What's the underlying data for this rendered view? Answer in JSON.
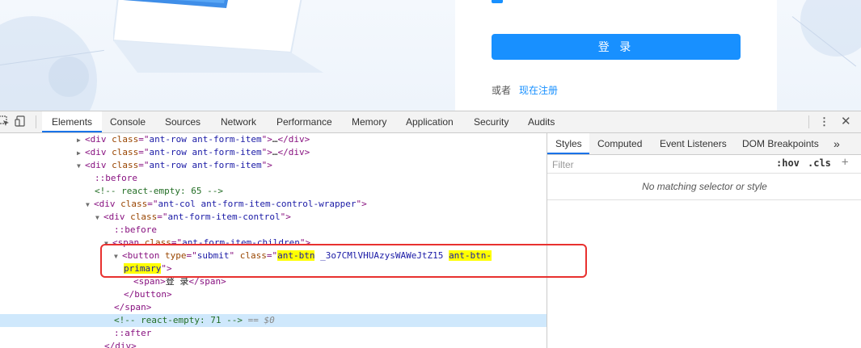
{
  "page": {
    "login_button": "登 录",
    "or_text": "或者",
    "register_link": "现在注册"
  },
  "devtools": {
    "tabs": [
      "Elements",
      "Console",
      "Sources",
      "Network",
      "Performance",
      "Memory",
      "Application",
      "Security",
      "Audits"
    ],
    "active_tab": "Elements",
    "accent_color": "#1a73e8",
    "highlight_color": "#e8312f",
    "icons": [
      "inspect-element-icon",
      "device-toolbar-icon",
      "more-options-icon",
      "close-icon"
    ],
    "dom": {
      "tag_div": "div",
      "attr_class": "class",
      "val_form_item": "ant-row ant-form-item",
      "collapsed_dots": "…",
      "before": "::before",
      "comment_react_65": "<!-- react-empty: 65 -->",
      "val_control_wrapper": "ant-col ant-form-item-control-wrapper",
      "val_form_item_control": "ant-form-item-control",
      "tag_span": "span",
      "val_children": "ant-form-item-children",
      "tag_button": "button",
      "attr_type": "type",
      "val_submit": "submit",
      "val_ant_btn": "ant-btn",
      "val_hash": " _3o7CMlVHUAzysWAWeJtZ15 ",
      "val_ant_btn2": "ant-btn-",
      "val_primary": "primary",
      "span_text": "登 录",
      "close_button": "</button>",
      "close_span": "</span>",
      "comment_react_71": "<!-- react-empty: 71 -->",
      "eq_dollar": " == $0",
      "after": "::after",
      "close_div": "</div>"
    },
    "sidebar": {
      "tabs": [
        "Styles",
        "Computed",
        "Event Listeners",
        "DOM Breakpoints"
      ],
      "active_tab": "Styles",
      "more_icon": "chevron-double-right-icon",
      "filter_placeholder": "Filter",
      "hov": ":hov",
      "cls": ".cls",
      "add": "+",
      "no_match": "No matching selector or style"
    }
  }
}
